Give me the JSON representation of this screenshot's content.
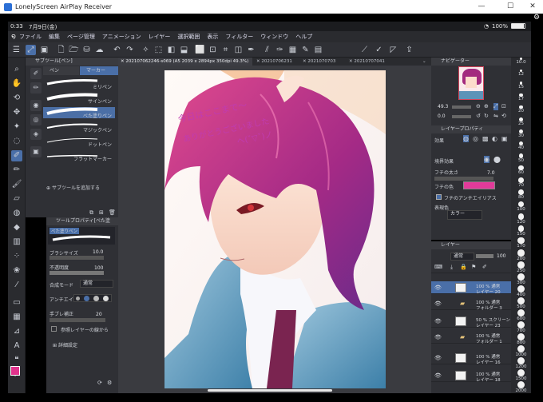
{
  "window": {
    "title": "LonelyScreen AirPlay Receiver",
    "minimize": "—",
    "maximize": "☐",
    "close": "✕"
  },
  "status": {
    "time": "0:33",
    "date": "7月9日(金)",
    "battery": "100%"
  },
  "menu": [
    "ファイル",
    "編集",
    "ページ管理",
    "アニメーション",
    "レイヤー",
    "選択範囲",
    "表示",
    "フィルター",
    "ウィンドウ",
    "ヘルプ"
  ],
  "subtool": {
    "header": "サブツール[ペン]",
    "tabs": [
      "ペン",
      "マーカー"
    ],
    "brushes": [
      "ミリペン",
      "サインペン",
      "べた塗りペン",
      "マジックペン",
      "ドットペン",
      "フラットマーカー"
    ],
    "selected_index": 2,
    "add_label": "サブツールを追加する"
  },
  "toolprop": {
    "header": "ツールプロパティ[べた塗",
    "preset": "べた塗りペン",
    "brush_size_label": "ブラシサイズ",
    "brush_size": "10.0",
    "opacity_label": "不透明度",
    "opacity": "100",
    "blend_label": "合成モード",
    "blend": "通常",
    "aa_label": "アンチエイリアス",
    "stabilize_label": "手ブレ補正",
    "stabilize": "20",
    "ref_label": "参照レイヤーの線から",
    "detail_label": "詳細設定"
  },
  "tabs": [
    "20210706224​6-s069 (A5 2039 x 2894px 350dpi 49.3%)",
    "20210706231",
    "2021070703",
    "20210707041"
  ],
  "artwork": {
    "text_line1": "今日はここまで〜",
    "text_line2": "ありがとうございました",
    "text_line3": "ヘ(ˇ▽ˇ)ノ"
  },
  "navigator": {
    "header": "ナビゲーター",
    "zoom": "49.3",
    "angle": "0.0"
  },
  "layerprop": {
    "header": "レイヤープロパティ",
    "effect_label": "効果",
    "border_label": "境界効果",
    "edge_size_label": "フチの太さ",
    "edge_size": "7.0",
    "edge_color_label": "フチの色",
    "edge_aa_label": "フチのアンチエイリアス",
    "expression_label": "表現色",
    "expression": "カラー"
  },
  "layers": {
    "header": "レイヤー",
    "blend": "通常",
    "opacity": "100",
    "rows": [
      {
        "a": "100 % 通常",
        "b": "レイヤー 20"
      },
      {
        "a": "100 % 通常",
        "b": "フォルダー 3"
      },
      {
        "a": "50 % スクリーン",
        "b": "レイヤー 23"
      },
      {
        "a": "100 % 通常",
        "b": "フォルダー 1"
      },
      {
        "a": "100 % 通常",
        "b": "レイヤー 16"
      },
      {
        "a": "100 % 通常",
        "b": "レイヤー 18"
      }
    ]
  },
  "brush_sizes": [
    "10.0",
    "12",
    "15",
    "17",
    "20",
    "25",
    "30",
    "40",
    "50",
    "60",
    "70",
    "80",
    "100",
    "120",
    "150",
    "170",
    "200",
    "250",
    "300",
    "400",
    "500",
    "600",
    "700",
    "800",
    "1000",
    "1200",
    "1500",
    "2000"
  ],
  "colors": {
    "accent": "#4a6fa8",
    "fg": "#e0338c",
    "edge": "#e23a9a"
  }
}
